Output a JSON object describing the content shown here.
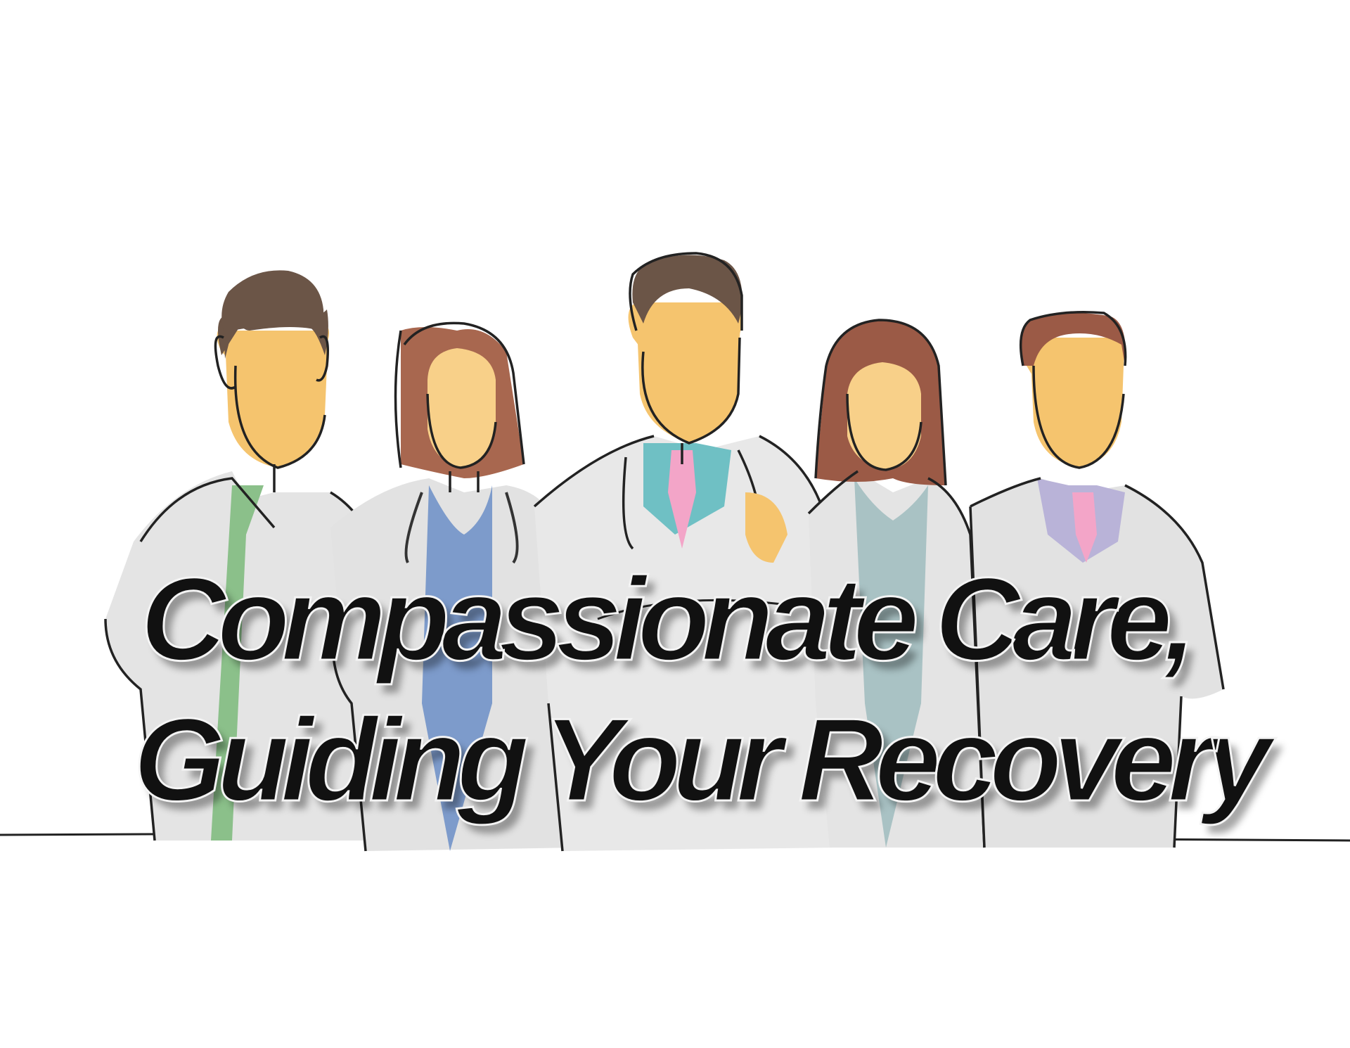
{
  "headline": {
    "line1": "Compassionate Care,",
    "line2": "Guiding Your Recovery"
  },
  "colors": {
    "skin": "#F5C46E",
    "skin_light": "#F8D089",
    "hair_dark": "#6B5547",
    "hair_brown": "#A8674F",
    "hair_chestnut": "#9B5A46",
    "coat": "#E6E6E6",
    "outline": "#222222",
    "scrub_green": "#8BC08A",
    "scrub_blue": "#7D9BCB",
    "shirt_teal": "#6FC0C4",
    "tie_pink": "#F3A5C8",
    "scrub_sage": "#A9C2C4",
    "shirt_lavender": "#B9B3D8",
    "text": "#111111"
  },
  "figures": [
    {
      "id": "doctor-1",
      "hair": "hair_dark",
      "top": "scrub_green"
    },
    {
      "id": "doctor-2",
      "hair": "hair_brown",
      "top": "scrub_blue"
    },
    {
      "id": "doctor-3",
      "hair": "hair_dark",
      "top": "shirt_teal"
    },
    {
      "id": "doctor-4",
      "hair": "hair_chestnut",
      "top": "scrub_sage"
    },
    {
      "id": "doctor-5",
      "hair": "hair_chestnut",
      "top": "shirt_lavender"
    }
  ]
}
